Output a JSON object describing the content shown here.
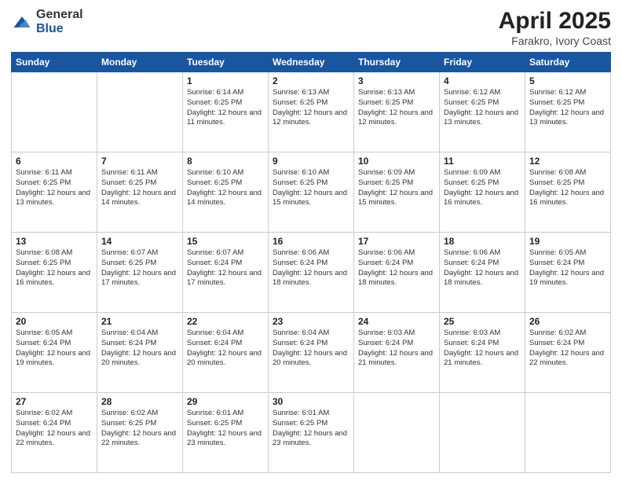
{
  "header": {
    "logo_general": "General",
    "logo_blue": "Blue",
    "title": "April 2025",
    "location": "Farakro, Ivory Coast"
  },
  "days_of_week": [
    "Sunday",
    "Monday",
    "Tuesday",
    "Wednesday",
    "Thursday",
    "Friday",
    "Saturday"
  ],
  "weeks": [
    [
      {
        "day": "",
        "info": ""
      },
      {
        "day": "",
        "info": ""
      },
      {
        "day": "1",
        "info": "Sunrise: 6:14 AM\nSunset: 6:25 PM\nDaylight: 12 hours and 11 minutes."
      },
      {
        "day": "2",
        "info": "Sunrise: 6:13 AM\nSunset: 6:25 PM\nDaylight: 12 hours and 12 minutes."
      },
      {
        "day": "3",
        "info": "Sunrise: 6:13 AM\nSunset: 6:25 PM\nDaylight: 12 hours and 12 minutes."
      },
      {
        "day": "4",
        "info": "Sunrise: 6:12 AM\nSunset: 6:25 PM\nDaylight: 12 hours and 13 minutes."
      },
      {
        "day": "5",
        "info": "Sunrise: 6:12 AM\nSunset: 6:25 PM\nDaylight: 12 hours and 13 minutes."
      }
    ],
    [
      {
        "day": "6",
        "info": "Sunrise: 6:11 AM\nSunset: 6:25 PM\nDaylight: 12 hours and 13 minutes."
      },
      {
        "day": "7",
        "info": "Sunrise: 6:11 AM\nSunset: 6:25 PM\nDaylight: 12 hours and 14 minutes."
      },
      {
        "day": "8",
        "info": "Sunrise: 6:10 AM\nSunset: 6:25 PM\nDaylight: 12 hours and 14 minutes."
      },
      {
        "day": "9",
        "info": "Sunrise: 6:10 AM\nSunset: 6:25 PM\nDaylight: 12 hours and 15 minutes."
      },
      {
        "day": "10",
        "info": "Sunrise: 6:09 AM\nSunset: 6:25 PM\nDaylight: 12 hours and 15 minutes."
      },
      {
        "day": "11",
        "info": "Sunrise: 6:09 AM\nSunset: 6:25 PM\nDaylight: 12 hours and 16 minutes."
      },
      {
        "day": "12",
        "info": "Sunrise: 6:08 AM\nSunset: 6:25 PM\nDaylight: 12 hours and 16 minutes."
      }
    ],
    [
      {
        "day": "13",
        "info": "Sunrise: 6:08 AM\nSunset: 6:25 PM\nDaylight: 12 hours and 16 minutes."
      },
      {
        "day": "14",
        "info": "Sunrise: 6:07 AM\nSunset: 6:25 PM\nDaylight: 12 hours and 17 minutes."
      },
      {
        "day": "15",
        "info": "Sunrise: 6:07 AM\nSunset: 6:24 PM\nDaylight: 12 hours and 17 minutes."
      },
      {
        "day": "16",
        "info": "Sunrise: 6:06 AM\nSunset: 6:24 PM\nDaylight: 12 hours and 18 minutes."
      },
      {
        "day": "17",
        "info": "Sunrise: 6:06 AM\nSunset: 6:24 PM\nDaylight: 12 hours and 18 minutes."
      },
      {
        "day": "18",
        "info": "Sunrise: 6:06 AM\nSunset: 6:24 PM\nDaylight: 12 hours and 18 minutes."
      },
      {
        "day": "19",
        "info": "Sunrise: 6:05 AM\nSunset: 6:24 PM\nDaylight: 12 hours and 19 minutes."
      }
    ],
    [
      {
        "day": "20",
        "info": "Sunrise: 6:05 AM\nSunset: 6:24 PM\nDaylight: 12 hours and 19 minutes."
      },
      {
        "day": "21",
        "info": "Sunrise: 6:04 AM\nSunset: 6:24 PM\nDaylight: 12 hours and 20 minutes."
      },
      {
        "day": "22",
        "info": "Sunrise: 6:04 AM\nSunset: 6:24 PM\nDaylight: 12 hours and 20 minutes."
      },
      {
        "day": "23",
        "info": "Sunrise: 6:04 AM\nSunset: 6:24 PM\nDaylight: 12 hours and 20 minutes."
      },
      {
        "day": "24",
        "info": "Sunrise: 6:03 AM\nSunset: 6:24 PM\nDaylight: 12 hours and 21 minutes."
      },
      {
        "day": "25",
        "info": "Sunrise: 6:03 AM\nSunset: 6:24 PM\nDaylight: 12 hours and 21 minutes."
      },
      {
        "day": "26",
        "info": "Sunrise: 6:02 AM\nSunset: 6:24 PM\nDaylight: 12 hours and 22 minutes."
      }
    ],
    [
      {
        "day": "27",
        "info": "Sunrise: 6:02 AM\nSunset: 6:24 PM\nDaylight: 12 hours and 22 minutes."
      },
      {
        "day": "28",
        "info": "Sunrise: 6:02 AM\nSunset: 6:25 PM\nDaylight: 12 hours and 22 minutes."
      },
      {
        "day": "29",
        "info": "Sunrise: 6:01 AM\nSunset: 6:25 PM\nDaylight: 12 hours and 23 minutes."
      },
      {
        "day": "30",
        "info": "Sunrise: 6:01 AM\nSunset: 6:25 PM\nDaylight: 12 hours and 23 minutes."
      },
      {
        "day": "",
        "info": ""
      },
      {
        "day": "",
        "info": ""
      },
      {
        "day": "",
        "info": ""
      }
    ]
  ]
}
